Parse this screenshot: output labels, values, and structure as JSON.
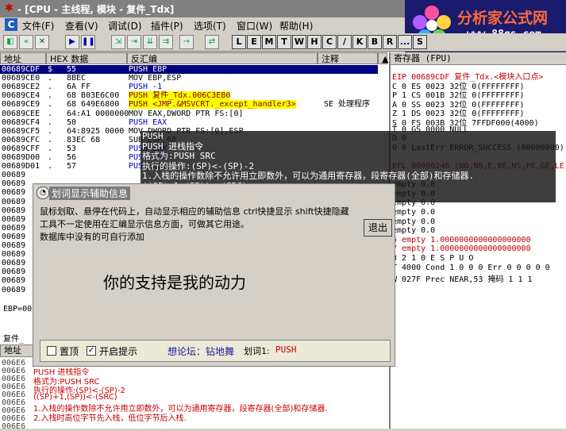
{
  "window": {
    "title": "- [CPU - 主线程, 模块 - 复件_Tdx]"
  },
  "menu": {
    "items": [
      "文件(F)",
      "查看(V)",
      "调试(D)",
      "插件(P)",
      "选项(T)",
      "窗口(W)",
      "帮助(H)"
    ]
  },
  "logo": {
    "brand": "分析家公式网",
    "url": "www.88gs.com"
  },
  "toolbar": {
    "letters": [
      "L",
      "E",
      "M",
      "T",
      "W",
      "H",
      "C",
      "/",
      "K",
      "B",
      "R",
      "...",
      "S"
    ]
  },
  "disasm": {
    "headers": {
      "address": "地址",
      "hex": "HEX 数据",
      "asm": "反汇编",
      "comment": "注释"
    },
    "rows": [
      {
        "addr": "00689CDF",
        "mark": "$",
        "hex": "55",
        "asm": "PUSH EBP",
        "comment": ""
      },
      {
        "addr": "00689CE0",
        "mark": ".",
        "hex": "8BEC",
        "asm": "MOV EBP,ESP",
        "comment": ""
      },
      {
        "addr": "00689CE2",
        "mark": ".",
        "hex": "6A FF",
        "asm": "PUSH -1",
        "comment": ""
      },
      {
        "addr": "00689CE4",
        "mark": ".",
        "hex": "68 B03E6C00",
        "asm": "PUSH 复件_Tdx.006C3EB0",
        "comment": ""
      },
      {
        "addr": "00689CE9",
        "mark": ".",
        "hex": "68 649E6800",
        "asm": "PUSH <JMP.&MSVCRT._except_handler3>",
        "comment": "SE 处理程序"
      },
      {
        "addr": "00689CEE",
        "mark": ".",
        "hex": "64:A1 0000000",
        "asm": "MOV EAX,DWORD PTR FS:[0]",
        "comment": ""
      },
      {
        "addr": "00689CF4",
        "mark": ".",
        "hex": "50",
        "asm": "PUSH EAX",
        "comment": ""
      },
      {
        "addr": "00689CF5",
        "mark": ".",
        "hex": "64:8925 0000",
        "asm": "MOV DWORD PTR FS:[0],ESP",
        "comment": ""
      },
      {
        "addr": "00689CFC",
        "mark": ".",
        "hex": "83EC 68",
        "asm": "SUB ESP,68",
        "comment": ""
      },
      {
        "addr": "00689CFF",
        "mark": ".",
        "hex": "53",
        "asm": "PUSH EBX",
        "comment": ""
      },
      {
        "addr": "00689D00",
        "mark": ".",
        "hex": "56",
        "asm": "PUSH ESI",
        "comment": ""
      },
      {
        "addr": "00689D01",
        "mark": ".",
        "hex": "57",
        "asm": "PUSH EDI",
        "comment": ""
      },
      {
        "addr": "00689",
        "mark": "",
        "hex": "",
        "asm": "",
        "comment": ""
      },
      {
        "addr": "00689",
        "mark": "",
        "hex": "",
        "asm": "",
        "comment": ""
      },
      {
        "addr": "00689",
        "mark": "",
        "hex": "",
        "asm": "",
        "comment": ""
      },
      {
        "addr": "00689",
        "mark": "",
        "hex": "",
        "asm": "",
        "comment": ""
      },
      {
        "addr": "00689",
        "mark": "",
        "hex": "",
        "asm": "",
        "comment": ""
      },
      {
        "addr": "00689",
        "mark": "",
        "hex": "",
        "asm": "",
        "comment": ""
      },
      {
        "addr": "00689",
        "mark": "",
        "hex": "",
        "asm": "",
        "comment": ""
      },
      {
        "addr": "00689",
        "mark": "",
        "hex": "",
        "asm": "",
        "comment": ""
      },
      {
        "addr": "00689",
        "mark": "",
        "hex": "",
        "asm": "",
        "comment": ""
      },
      {
        "addr": "00689",
        "mark": "",
        "hex": "",
        "asm": "",
        "comment": ""
      },
      {
        "addr": "00689",
        "mark": "",
        "hex": "",
        "asm": "",
        "comment": ""
      },
      {
        "addr": "00689",
        "mark": "",
        "hex": "",
        "asm": "",
        "comment": ""
      },
      {
        "addr": "00689",
        "mark": "",
        "hex": "",
        "asm": "",
        "comment": ""
      },
      {
        "addr": "00689",
        "mark": "",
        "hex": "",
        "asm": "",
        "comment": ""
      }
    ],
    "ebp_line": "EBP=00"
  },
  "registers": {
    "header": "寄存器 (FPU)",
    "lines": [
      "EIP 00689CDF 复件_Tdx.<模块入口点>",
      "C 0  ES 0023 32位 0(FFFFFFFF)",
      "P 1  CS 001B 32位 0(FFFFFFFF)",
      "A 0  SS 0023 32位 0(FFFFFFFF)",
      "Z 1  DS 0023 32位 0(FFFFFFFF)",
      "S 0  FS 003B 32位 7FFDF000(4000)",
      "T 0  GS 0000 NULL",
      "D 0",
      "O 0  LastErr ERROR_SUCCESS (00000000)",
      "",
      "EFL 00000246 (NO,NB,E,BE,NS,PE,GE,LE)",
      "",
      "   empty 0.0",
      "   empty 0.0",
      "   empty 0.0",
      "   empty 0.0",
      "   empty 0.0",
      "   empty 0.0",
      "6  empty 1.0000000000000000000",
      "7  empty 1.0000000000000000000",
      "              3 2 1 0      E S P U O",
      "T  4000  Cond 1 0 0 0  Err 0 0 0 0 0",
      "W  027F  Prec NEAR,53  掩码    1 1 1"
    ]
  },
  "tooltip": {
    "lines": [
      "PUSH",
      "PUSH 进栈指令",
      "格式为:PUSH SRC",
      "执行的操作:(SP)<-(SP)-2",
      "1.入栈的操作数除不允许用立即数外，可以为通用寄存器，段寄存器(全部)和存储器.",
      "((SP)+1,(SP))<-(SRC)",
      "2.入栈时高位字节先入栈，低位字节后入栈."
    ]
  },
  "helper": {
    "title": "划词显示辅助信息",
    "desc_lines": [
      "鼠标划取、悬停在代码上，自动显示相应的辅助信息 ctrl快捷显示    shift快捷隐藏",
      "工具不一定使用在汇编显示信息方面，可做其它用途。",
      "数据库中没有的可自行添加"
    ],
    "exit_label": "退出",
    "slogan": "你的支持是我的动力",
    "topmost_label": "置顶",
    "tips_label": "开启提示",
    "topmost_checked": false,
    "tips_checked": true,
    "forum_label": "想论坛：钻地舞",
    "word_label": "划词1:",
    "word_value": "PUSH"
  },
  "lower": {
    "file_label": "复件_",
    "header": "地址",
    "addrs": [
      "006E6",
      "006E6",
      "006E6",
      "006E6",
      "006E6",
      "006E6",
      "006E6",
      "006E6",
      "006E6"
    ],
    "info_lines": [
      "PUSH 进栈指令",
      "格式为:PUSH SRC",
      "执行的操作:(SP)<-(SP)-2",
      "((SP)+1,(SP))<-(SRC)",
      "1.入栈的操作数除不允许用立即数外，可以为通用寄存器，段寄存器(全部)和存储器.",
      "2.入栈时高位字节先入栈，低位字节后入栈."
    ]
  }
}
